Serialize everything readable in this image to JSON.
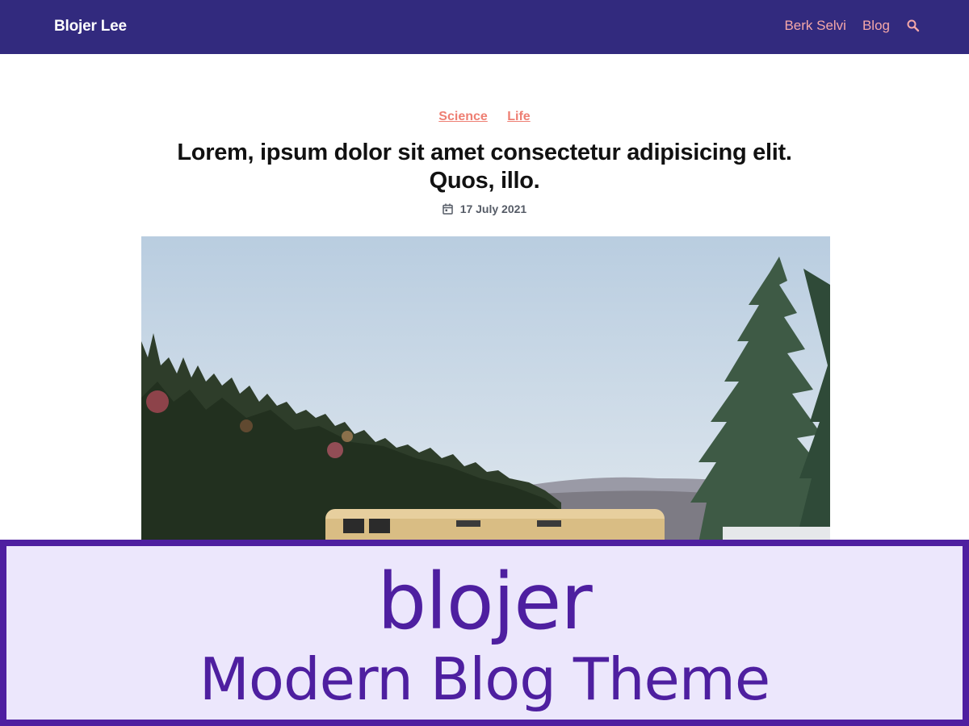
{
  "header": {
    "brand": "Blojer Lee",
    "nav": [
      {
        "label": "Berk Selvi"
      },
      {
        "label": "Blog"
      }
    ],
    "search_icon": "search-icon"
  },
  "article": {
    "categories": [
      {
        "label": "Science"
      },
      {
        "label": "Life"
      }
    ],
    "title_line1": "Lorem, ipsum dolor sit amet consectetur adipisicing elit.",
    "title_line2": "Quos, illo.",
    "date": "17 July 2021",
    "date_icon": "calendar-icon",
    "hero_image": "forest-and-school-bus-photo"
  },
  "banner": {
    "logo": "blojer",
    "tagline": "Modern Blog Theme"
  },
  "colors": {
    "header_bg": "#322a7e",
    "nav_link": "#f4a7a8",
    "category": "#ee7f73",
    "banner_accent": "#4e1fa0",
    "banner_bg": "#ece7fc"
  }
}
